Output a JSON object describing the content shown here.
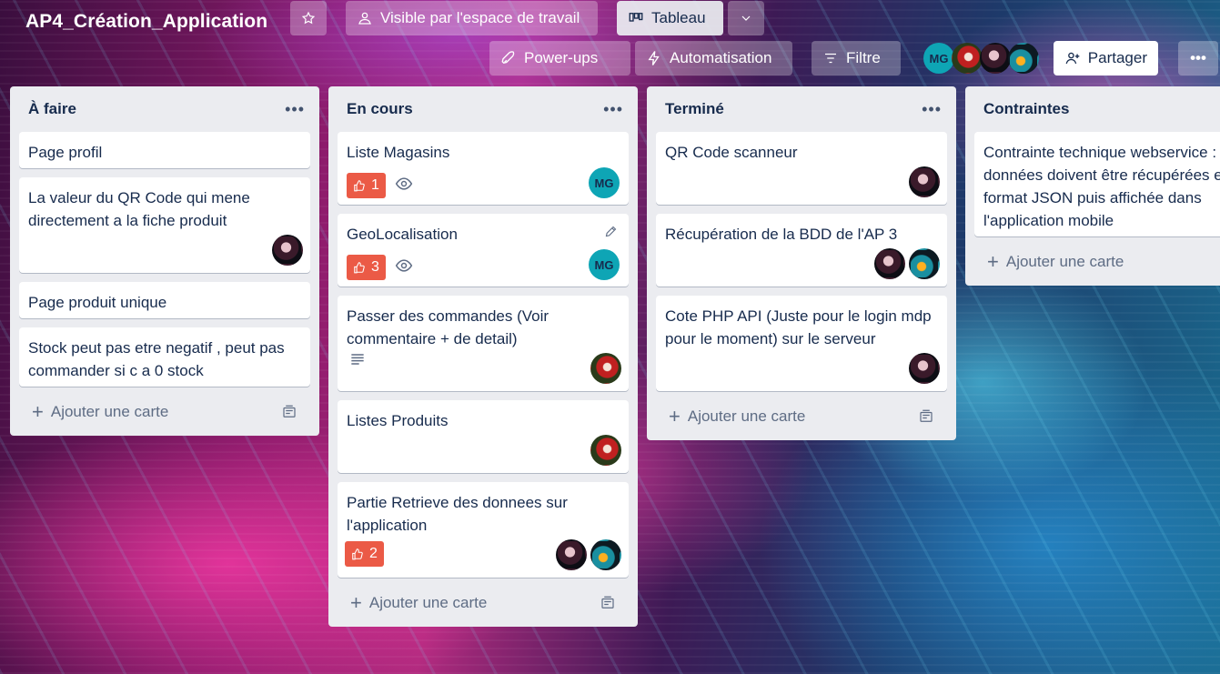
{
  "header": {
    "board_title": "AP4_Création_Application",
    "visibility_label": "Visible par l'espace de travail",
    "view_label": "Tableau",
    "powerups_label": "Power-ups",
    "automation_label": "Automatisation",
    "filter_label": "Filtre",
    "share_label": "Partager",
    "more_label": "•••",
    "member_initials": "MG"
  },
  "lists": [
    {
      "title": "À faire",
      "menu": "•••",
      "cards": [
        {
          "title": "Page profil"
        },
        {
          "title": "La valeur du QR Code qui mene directement a la fiche produit"
        },
        {
          "title": "Page produit unique"
        },
        {
          "title": "Stock peut pas etre negatif , peut pas commander si c a 0 stock"
        }
      ],
      "add_label": "Ajouter une carte"
    },
    {
      "title": "En cours",
      "menu": "•••",
      "cards": [
        {
          "title": "Liste Magasins",
          "votes": "1",
          "member": "MG"
        },
        {
          "title": "GeoLocalisation",
          "votes": "3",
          "member": "MG"
        },
        {
          "title": "Passer des commandes (Voir commentaire + de detail)"
        },
        {
          "title": "Listes Produits"
        },
        {
          "title": "Partie Retrieve des donnees sur l'application",
          "votes": "2"
        }
      ],
      "add_label": "Ajouter une carte"
    },
    {
      "title": "Terminé",
      "menu": "•••",
      "cards": [
        {
          "title": "QR Code scanneur"
        },
        {
          "title": "Récupération de la BDD de l'AP 3"
        },
        {
          "title": "Cote PHP API (Juste pour le login mdp pour le moment) sur le serveur"
        }
      ],
      "add_label": "Ajouter une carte"
    },
    {
      "title": "Contraintes",
      "cards": [
        {
          "title": "Contrainte technique webservice : données doivent être récupérées e format JSON puis affichée dans l'application mobile"
        }
      ],
      "add_label": "Ajouter une carte"
    }
  ],
  "colors": {
    "list_bg": "#ebecf0",
    "vote_badge": "#eb5a46",
    "member_mg": "#0ea5b5",
    "text": "#172b4d"
  }
}
